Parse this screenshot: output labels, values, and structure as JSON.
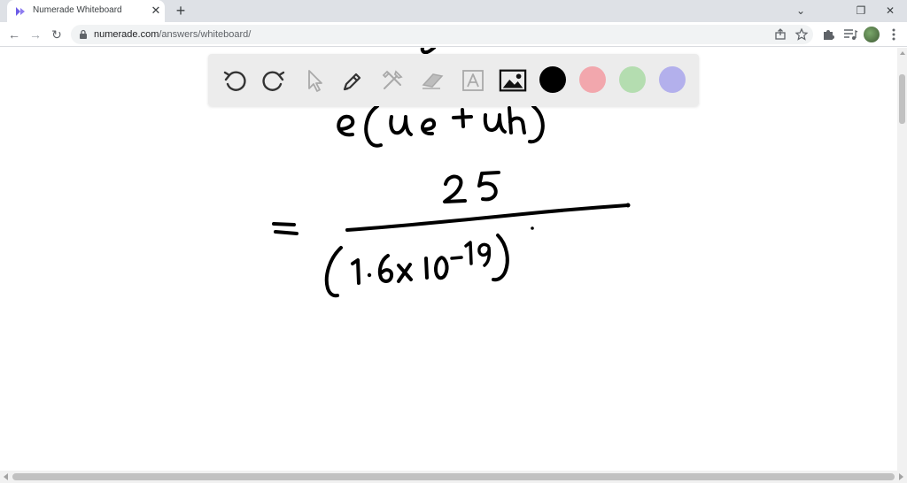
{
  "browser": {
    "tab": {
      "title": "Numerade Whiteboard",
      "favicon": "numerade-logo-icon",
      "close": "✕"
    },
    "new_tab_label": "+",
    "window_controls": {
      "dropdown": "⌄",
      "restore": "❐",
      "close": "✕"
    },
    "nav": {
      "back": "←",
      "forward": "→",
      "reload": "↻"
    },
    "address": {
      "host": "numerade.com",
      "path": "/answers/whiteboard/"
    },
    "icons": [
      "share-icon",
      "bookmark-star-icon",
      "extensions-puzzle-icon",
      "media-controls-icon",
      "profile-avatar",
      "menu-kebab-icon"
    ]
  },
  "whiteboard": {
    "tools": [
      "undo-icon",
      "redo-icon",
      "select-pointer-icon",
      "pen-icon",
      "tools-icon",
      "eraser-icon",
      "text-icon",
      "image-icon"
    ],
    "colors": [
      {
        "name": "black",
        "hex": "#000000"
      },
      {
        "name": "pink",
        "hex": "#f2a7ad"
      },
      {
        "name": "green",
        "hex": "#b4ddb0"
      },
      {
        "name": "lavender",
        "hex": "#b3b0ec"
      }
    ],
    "active_color": "#000000",
    "ink_color": "#000000"
  }
}
